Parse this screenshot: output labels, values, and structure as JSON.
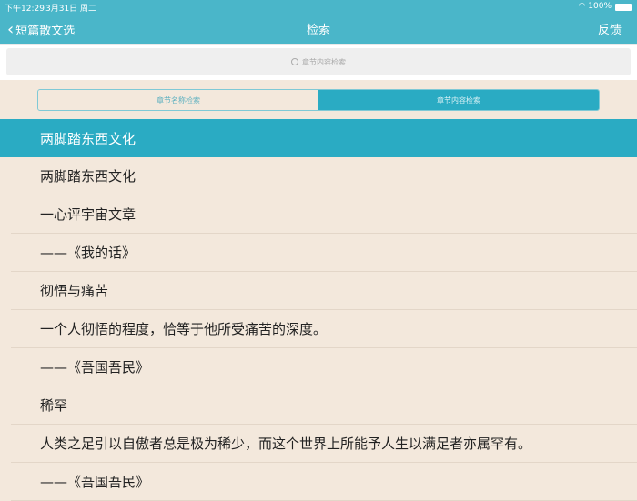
{
  "status": {
    "time": "下午12:29",
    "date": "3月31日 周二",
    "battery": "100%"
  },
  "nav": {
    "back": "短篇散文选",
    "title": "检索",
    "right": "反馈"
  },
  "search": {
    "placeholder": "章节内容检索"
  },
  "segments": [
    {
      "label": "章节名称检索",
      "active": false
    },
    {
      "label": "章节内容检索",
      "active": true
    }
  ],
  "results": [
    "两脚踏东西文化",
    "两脚踏东西文化",
    "一心评宇宙文章",
    "——《我的话》",
    "彻悟与痛苦",
    "一个人彻悟的程度，恰等于他所受痛苦的深度。",
    "——《吾国吾民》",
    "稀罕",
    "人类之足引以自傲者总是极为稀少，而这个世界上所能予人生以满足者亦属罕有。",
    "——《吾国吾民》"
  ],
  "colors": {
    "accent": "#2aabc3",
    "bar": "#4ab6c9",
    "bg": "#f3e8dc"
  }
}
